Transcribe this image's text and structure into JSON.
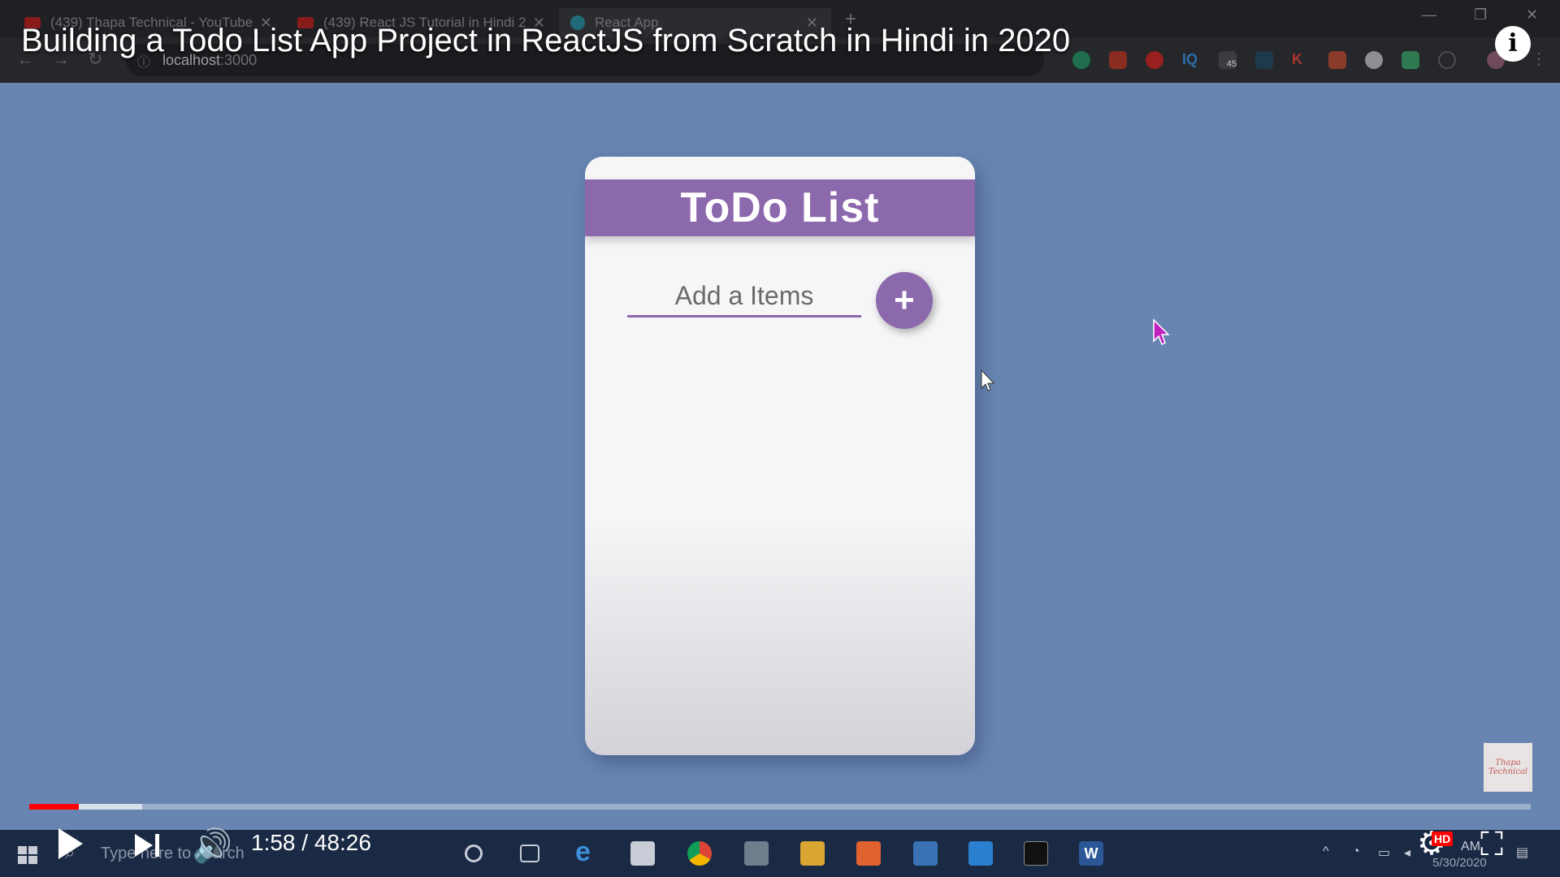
{
  "browser": {
    "tabs": [
      {
        "label": "(439) Thapa Technical - YouTube",
        "icon": "youtube-icon"
      },
      {
        "label": "(439) React JS Tutorial in Hindi 2",
        "icon": "youtube-icon"
      },
      {
        "label": "React App",
        "icon": "react-icon"
      }
    ],
    "address": {
      "host": "localhost",
      "port": ":3000"
    },
    "extension_badge": "45"
  },
  "video": {
    "title": "Building a Todo List App Project in ReactJS from Scratch in Hindi in 2020",
    "info_label": "i",
    "current_time": "1:58",
    "duration": "48:26",
    "time_display": "1:58 / 48:26",
    "progress_played_fraction": 0.033,
    "progress_buffered_fraction": 0.075,
    "hd_label": "HD",
    "watermark_text": "Thapa Technical"
  },
  "app": {
    "title": "ToDo List",
    "input_placeholder": "Add a Items",
    "add_button_label": "+"
  },
  "taskbar": {
    "search_placeholder": "Type here to search",
    "clock_partial": "AM",
    "date": "5/30/2020"
  },
  "colors": {
    "page_background": "#6885b2",
    "accent_purple": "#8c68ac",
    "progress_red": "#ff0000",
    "taskbar": "#1b2a44"
  }
}
